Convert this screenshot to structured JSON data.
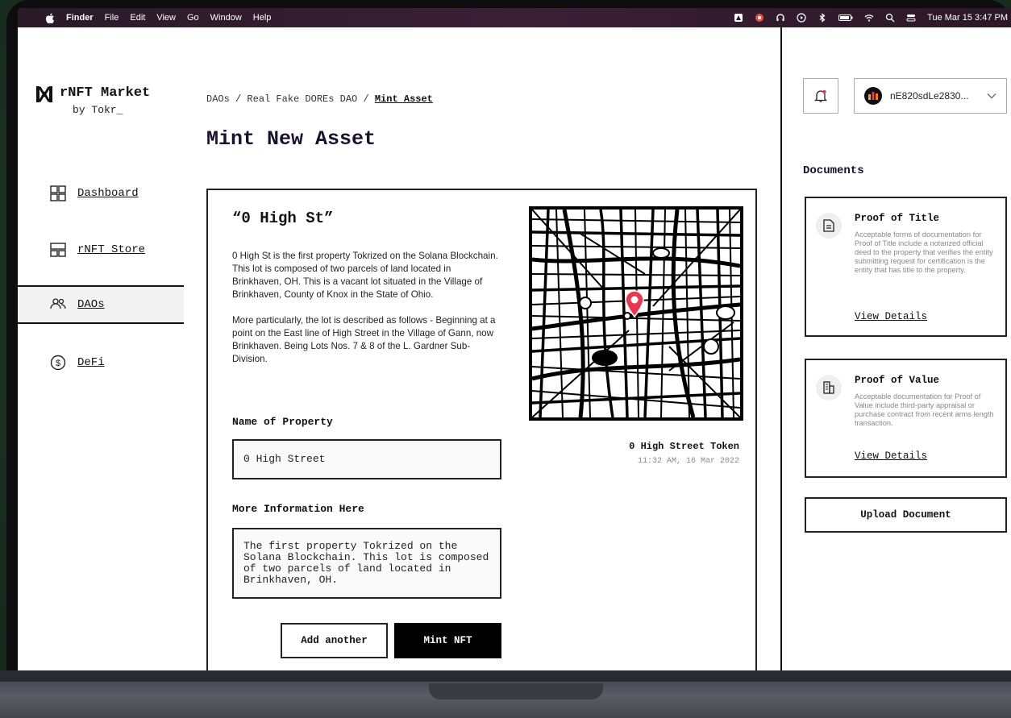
{
  "menubar": {
    "app": "Finder",
    "items": [
      "File",
      "Edit",
      "View",
      "Go",
      "Window",
      "Help"
    ],
    "clock": "Tue Mar 15  3:47 PM"
  },
  "sidebar": {
    "logo_title": "rNFT Market",
    "logo_sub": "by Tokr_",
    "items": [
      {
        "label": "Dashboard",
        "icon": "dashboard-grid-icon"
      },
      {
        "label": "rNFT Store",
        "icon": "store-icon"
      },
      {
        "label": "DAOs",
        "icon": "users-icon",
        "active": true
      },
      {
        "label": "DeFi",
        "icon": "dollar-circle-icon"
      }
    ]
  },
  "breadcrumb": {
    "part1": "DAOs",
    "sep": "/",
    "part2": "Real Fake DOREs DAO",
    "current": "Mint Asset"
  },
  "page_title": "Mint New Asset",
  "asset": {
    "title": "“0 High St”",
    "description_1": "0 High St is the first property Tokrized on the Solana Blockchain. This lot is composed of two parcels of land located in Brinkhaven, OH. This is a vacant lot situated in the Village of Brinkhaven, County of Knox in the State of Ohio.",
    "description_2": "More particularly, the lot is described as follows - Beginning at a point on the East line of High Street in the Village of Gann, now Brinkhaven. Being Lots Nos. 7 & 8 of the L. Gardner Sub-Division.",
    "name_label": "Name of Property",
    "name_value": "0 High Street",
    "more_label": "More Information Here",
    "more_value": "The first property Tokrized on the Solana Blockchain. This lot is composed of two parcels of land located in Brinkhaven, OH.",
    "add_button": "Add another",
    "mint_button": "Mint NFT",
    "token_name": "0 High Street Token",
    "token_date": "11:32 AM, 16 Mar 2022"
  },
  "right_panel": {
    "wallet": "nE820sdLe2830...",
    "docs_title": "Documents",
    "docs": [
      {
        "title": "Proof of Title",
        "icon": "document-icon",
        "desc": "Acceptable forms of documentation for Proof of Title include a notarized official deed to the property that verifies the entity submitting request for certification is the entity that has title to the property.",
        "link": "View Details"
      },
      {
        "title": "Proof of Value",
        "icon": "building-icon",
        "desc": "Acceptable documentation for Proof of Value include third-party appraisal or purchase contract from recent arms length transaction.",
        "link": "View Details"
      }
    ],
    "upload_button": "Upload Document"
  },
  "colors": {
    "accent_dark": "#1a0f2e",
    "pin": "#e8384f",
    "menubar": "#3a1f35"
  }
}
